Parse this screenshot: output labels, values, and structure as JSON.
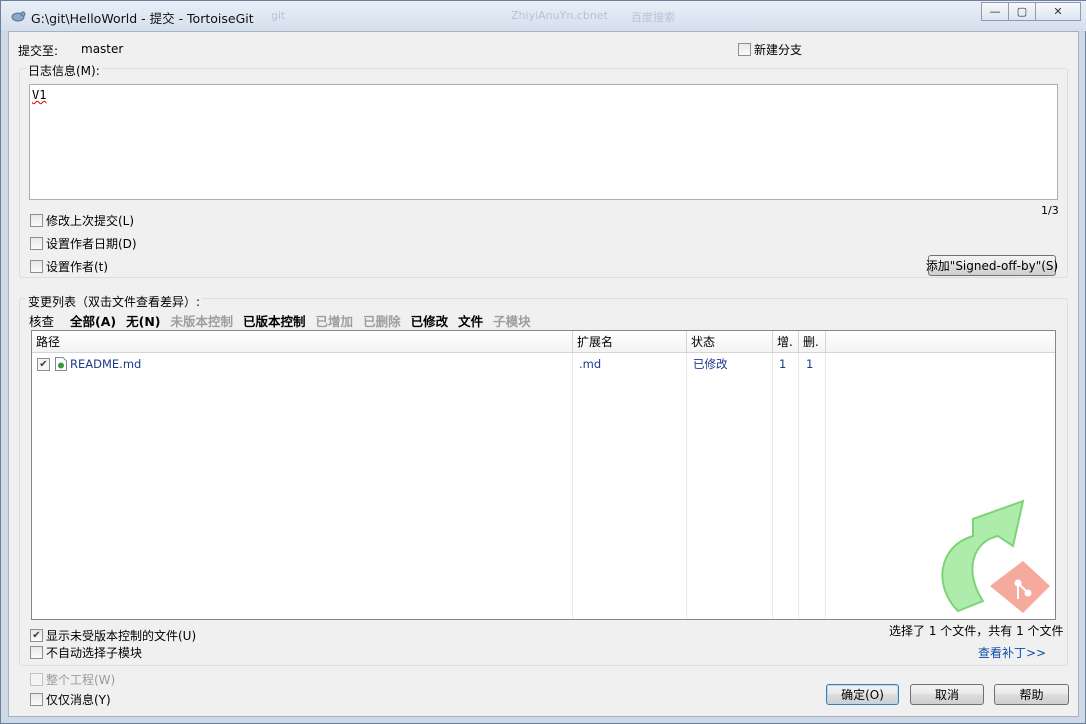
{
  "window": {
    "title": "G:\\git\\HelloWorld - 提交 - TortoiseGit",
    "ghost_titles": [
      "git",
      "ZhiyiAnuYn.cbnet",
      "百度搜索"
    ],
    "minimize_glyph": "—",
    "maximize_glyph": "▢",
    "close_glyph": "✕"
  },
  "commit_to": {
    "label": "提交至:",
    "branch": "master"
  },
  "new_branch": {
    "label": "新建分支",
    "checked": false
  },
  "message": {
    "label": "日志信息(M):",
    "text": "V1",
    "counter": "1/3"
  },
  "options": {
    "amend": "修改上次提交(L)",
    "set_date": "设置作者日期(D)",
    "set_author": "设置作者(t)",
    "signed_off_button": "添加\"Signed-off-by\"(S)"
  },
  "changes": {
    "label": "变更列表（双击文件查看差异）:",
    "filters": [
      {
        "text": "核查",
        "style": "first"
      },
      {
        "text": "全部(A)",
        "style": "bold"
      },
      {
        "text": "无(N)",
        "style": "bold"
      },
      {
        "text": "未版本控制",
        "style": "dim"
      },
      {
        "text": "已版本控制",
        "style": "bold"
      },
      {
        "text": "已增加",
        "style": "dim"
      },
      {
        "text": "已删除",
        "style": "dim"
      },
      {
        "text": "已修改",
        "style": "bold"
      },
      {
        "text": "文件",
        "style": "bold"
      },
      {
        "text": "子模块",
        "style": "dim"
      }
    ],
    "columns": [
      "路径",
      "扩展名",
      "状态",
      "增.",
      "删."
    ],
    "rows": [
      {
        "checked": true,
        "path": "README.md",
        "ext": ".md",
        "status": "已修改",
        "added": "1",
        "deleted": "1"
      }
    ],
    "show_unversioned": {
      "label": "显示未受版本控制的文件(U)",
      "checked": true
    },
    "no_auto_submodule": {
      "label": "不自动选择子模块",
      "checked": false
    },
    "selection_summary": "选择了 1 个文件，共有 1 个文件",
    "view_patch": "查看补丁>>"
  },
  "bottom": {
    "whole_project": {
      "label": "整个工程(W)",
      "checked": false,
      "enabled": false
    },
    "message_only": {
      "label": "仅仅消息(Y)",
      "checked": false
    },
    "ok": "确定(O)",
    "cancel": "取消",
    "help": "帮助"
  },
  "colors": {
    "link": "#0b4fa8",
    "list_text": "#1a3a8a",
    "logo_green": "#7cd87a",
    "logo_red": "#f07a6a"
  }
}
